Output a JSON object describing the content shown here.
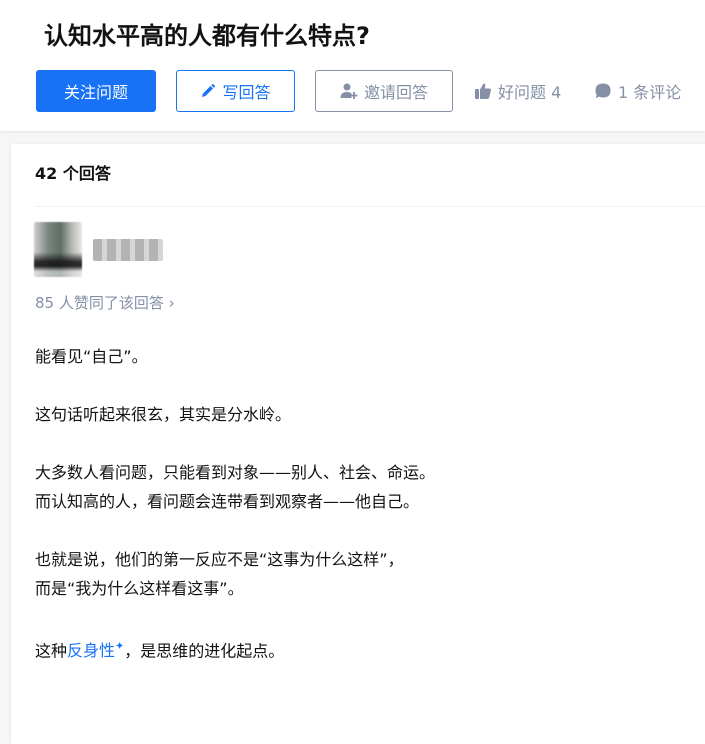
{
  "question": {
    "title": "认知水平高的人都有什么特点?"
  },
  "actions": {
    "follow_label": "关注问题",
    "write_label": "写回答",
    "invite_label": "邀请回答",
    "good_question_label": "好问题 4",
    "comment_label": "1 条评论"
  },
  "answers": {
    "count_label": "42 个回答"
  },
  "answer": {
    "author_name": "",
    "voters_label": "85 人赞同了该回答 ›",
    "paragraphs": {
      "p1": "能看见“自己”。",
      "p2": "这句话听起来很玄，其实是分水岭。",
      "p3a": "大多数人看问题，只能看到对象——别人、社会、命运。",
      "p3b": "而认知高的人，看问题会连带看到观察者——他自己。",
      "p4a": "也就是说，他们的第一反应不是“这事为什么这样”，",
      "p4b": "而是“我为什么这样看这事”。",
      "p5_prefix": "这种",
      "p5_link": "反身性",
      "p5_link_mark": "✦",
      "p5_suffix": "，是思维的进化起点。"
    }
  },
  "colors": {
    "brand_blue": "#1772f6",
    "muted_gray": "#8590a6",
    "text": "#121212"
  },
  "icons": [
    "pencil-icon",
    "invite-user-icon",
    "thumbs-up-icon",
    "comment-bubble-icon",
    "chevron-right-icon"
  ]
}
